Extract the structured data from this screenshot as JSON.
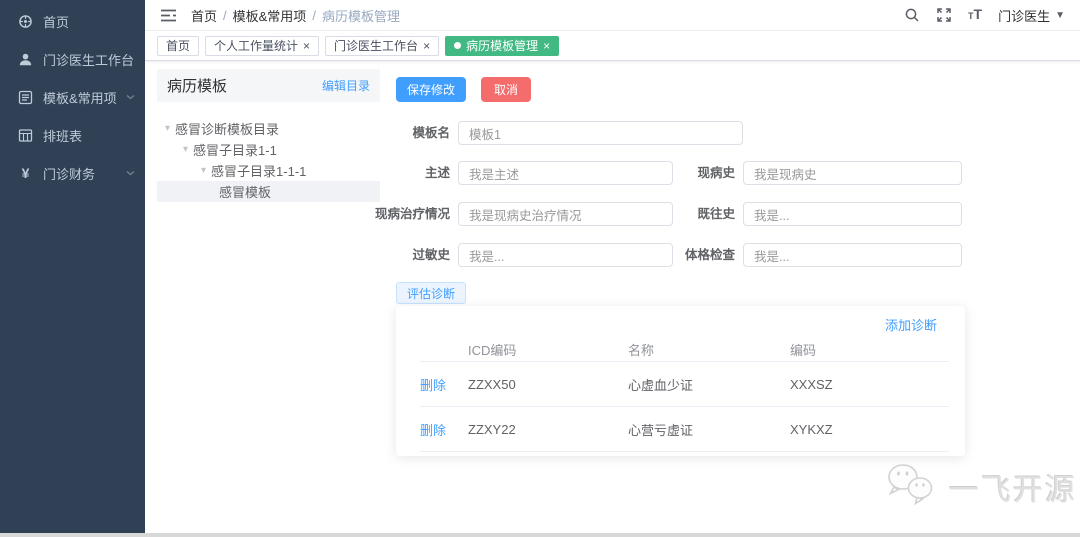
{
  "colors": {
    "primary": "#409eff",
    "danger": "#f56c6c",
    "tab_active": "#42b983",
    "sidebar_bg": "#304156",
    "link": "#409eff"
  },
  "sidebar": {
    "items": [
      {
        "label": "首页",
        "icon": "dashboard-icon",
        "has_submenu": false
      },
      {
        "label": "门诊医生工作台",
        "icon": "doctor-workbench-icon",
        "has_submenu": false
      },
      {
        "label": "模板&常用项",
        "icon": "template-list-icon",
        "has_submenu": true
      },
      {
        "label": "排班表",
        "icon": "schedule-table-icon",
        "has_submenu": false
      },
      {
        "label": "门诊财务",
        "icon": "finance-yen-icon",
        "has_submenu": true
      }
    ]
  },
  "navbar": {
    "breadcrumb": {
      "items": [
        "首页",
        "模板&常用项",
        "病历模板管理"
      ],
      "separator": "/"
    },
    "user_menu": {
      "label": "门诊医生"
    }
  },
  "tags_view": {
    "close_glyph": "×",
    "tabs": [
      {
        "label": "首页",
        "closable": false,
        "active": false
      },
      {
        "label": "个人工作量统计",
        "closable": true,
        "active": false
      },
      {
        "label": "门诊医生工作台",
        "closable": true,
        "active": false
      },
      {
        "label": "病历模板管理",
        "closable": true,
        "active": true
      }
    ]
  },
  "template_panel": {
    "title": "病历模板",
    "edit_link": "编辑目录",
    "caret_glyph": "▾",
    "tree": [
      {
        "label": "感冒诊断模板目录",
        "level": 0,
        "expanded": true,
        "selected": false
      },
      {
        "label": "感冒子目录1-1",
        "level": 1,
        "expanded": true,
        "selected": false
      },
      {
        "label": "感冒子目录1-1-1",
        "level": 2,
        "expanded": true,
        "selected": false
      },
      {
        "label": "感冒模板",
        "level": 3,
        "selected": true
      }
    ]
  },
  "editor": {
    "save_button": "保存修改",
    "cancel_button": "取消",
    "fields": [
      {
        "label": "模板名",
        "value": "模板1"
      },
      {
        "label": "主述",
        "value": "我是主述"
      },
      {
        "label": "现病史",
        "value": "我是现病史"
      },
      {
        "label": "现病治疗情况",
        "value": "我是现病史治疗情况"
      },
      {
        "label": "既往史",
        "value": "我是..."
      },
      {
        "label": "过敏史",
        "value": "我是..."
      },
      {
        "label": "体格检查",
        "value": "我是..."
      }
    ],
    "diagnosis_tab": "评估诊断",
    "diagnosis_table": {
      "add_link": "添加诊断",
      "action_label": "删除",
      "columns": [
        "ICD编码",
        "名称",
        "编码"
      ],
      "rows": [
        {
          "icd": "ZZXX50",
          "name": "心虚血少证",
          "code": "XXXSZ"
        },
        {
          "icd": "ZZXY22",
          "name": "心营亏虚证",
          "code": "XYKXZ"
        }
      ]
    }
  },
  "watermark": {
    "text": "一飞开源",
    "icon": "chat-bubbles-logo"
  }
}
